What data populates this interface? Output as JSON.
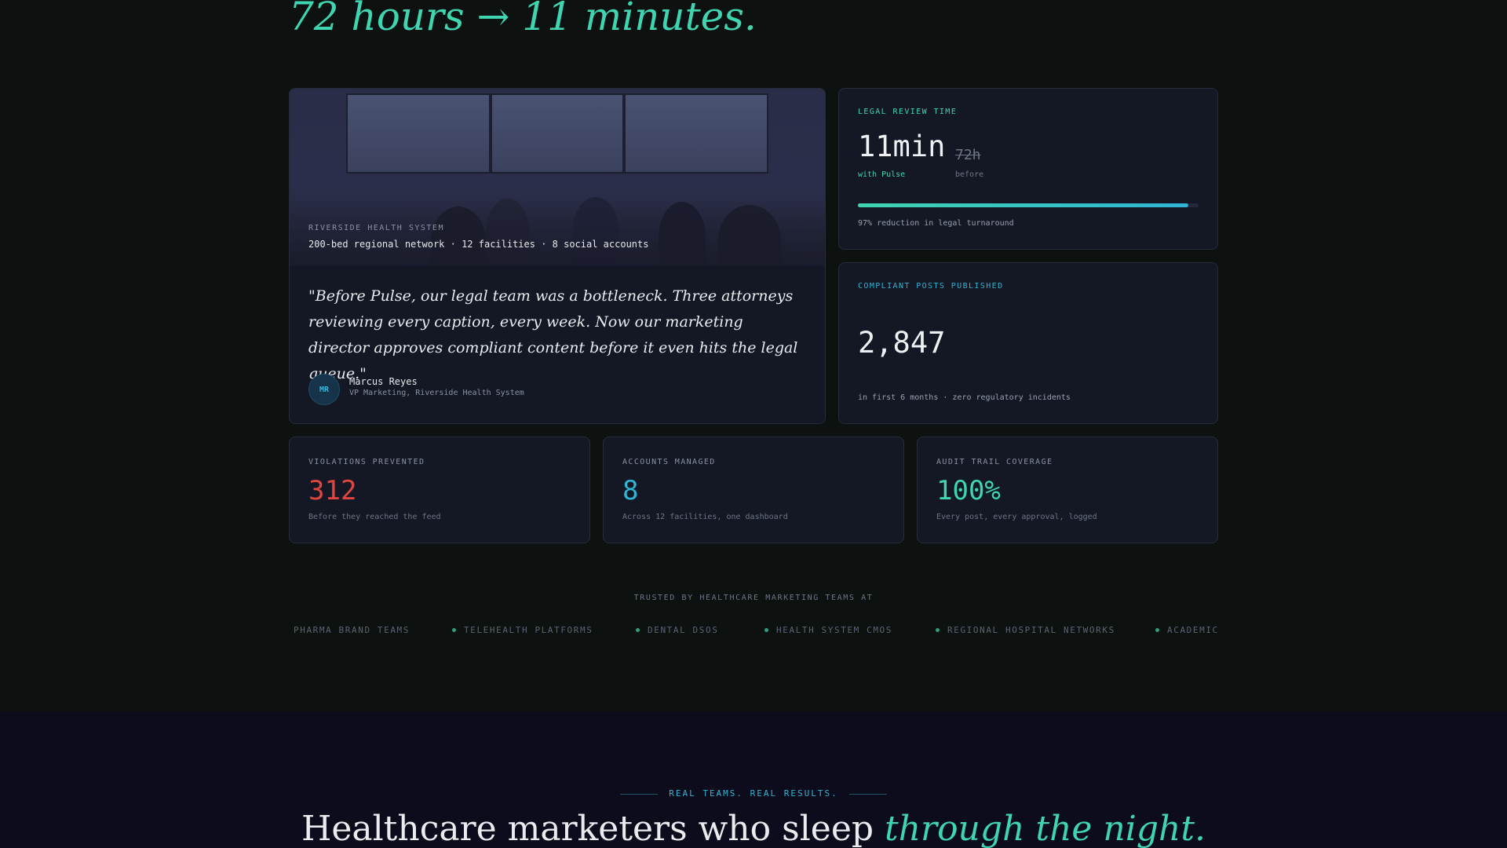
{
  "hero": {
    "line": "72 hours → 11 minutes."
  },
  "case_study": {
    "org_label": "RIVERSIDE HEALTH SYSTEM",
    "org_details": "200-bed regional network · 12 facilities · 8 social accounts",
    "quote": "\"Before Pulse, our legal team was a bottleneck. Three attorneys reviewing every caption, every week. Now our marketing director approves compliant content before it even hits the legal queue.\"",
    "author_initials": "MR",
    "author_name": "Marcus Reyes",
    "author_role": "VP Marketing, Riverside Health System"
  },
  "review_time": {
    "label": "LEGAL REVIEW TIME",
    "value": "11min",
    "value_caption": "with Pulse",
    "old_value": "72h",
    "old_caption": "before",
    "progress": 0.97,
    "note": "97% reduction in legal turnaround"
  },
  "posts": {
    "label": "COMPLIANT POSTS PUBLISHED",
    "value": "2,847",
    "note": "in first 6 months · zero regulatory incidents"
  },
  "stats": [
    {
      "label": "VIOLATIONS PREVENTED",
      "value": "312",
      "note": "Before they reached the feed",
      "color": "#e0463f"
    },
    {
      "label": "ACCOUNTS MANAGED",
      "value": "8",
      "note": "Across 12 facilities, one dashboard",
      "color": "#2fb4d4"
    },
    {
      "label": "AUDIT TRAIL COVERAGE",
      "value": "100%",
      "note": "Every post, every approval, logged",
      "color": "#3fd5b0"
    }
  ],
  "trusted": {
    "label": "TRUSTED BY HEALTHCARE MARKETING TEAMS AT",
    "logos": [
      "PHARMA BRAND TEAMS",
      "TELEHEALTH PLATFORMS",
      "DENTAL DSOS",
      "HEALTH SYSTEM CMOS",
      "REGIONAL HOSPITAL NETWORKS",
      "ACADEMIC"
    ]
  },
  "results": {
    "kicker": "REAL TEAMS. REAL RESULTS.",
    "headline_plain": "Healthcare marketers who sleep ",
    "headline_emphasis": "through the night."
  },
  "colors": {
    "accent_green": "#3fd5b0",
    "accent_blue": "#2fb4d4",
    "danger_red": "#e0463f"
  }
}
